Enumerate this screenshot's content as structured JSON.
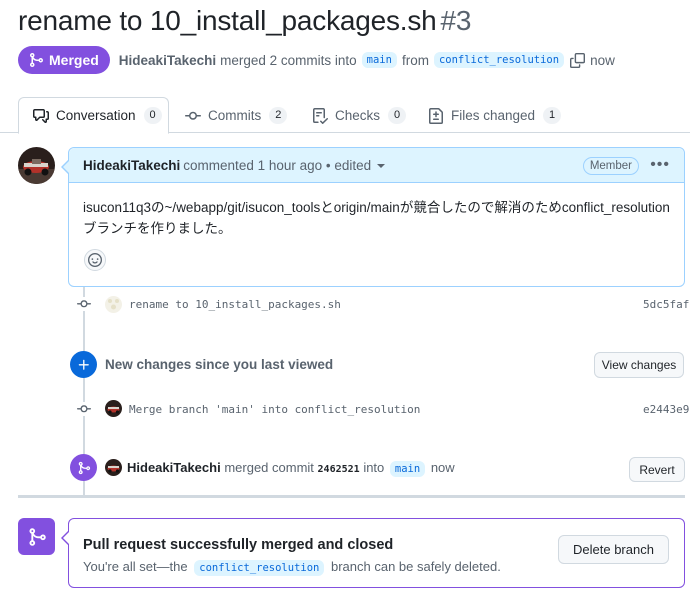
{
  "header": {
    "title": "rename to 10_install_packages.sh",
    "number": "#3",
    "state": "Merged",
    "author": "HideakiTakechi",
    "merge_text": "merged 2 commits into",
    "base_branch": "main",
    "from_text": "from",
    "head_branch": "conflict_resolution",
    "time": "now"
  },
  "tabs": [
    {
      "label": "Conversation",
      "count": "0",
      "icon": "comment-discussion-icon"
    },
    {
      "label": "Commits",
      "count": "2",
      "icon": "git-commit-icon"
    },
    {
      "label": "Checks",
      "count": "0",
      "icon": "checklist-icon"
    },
    {
      "label": "Files changed",
      "count": "1",
      "icon": "file-diff-icon"
    }
  ],
  "comment": {
    "author": "HideakiTakechi",
    "action": "commented 1 hour ago",
    "edited": "• edited",
    "role": "Member",
    "body": "isucon11q3の~/webapp/git/isucon_toolsとorigin/mainが競合したので解消のためconflict_resolutionブランチを作りました。"
  },
  "timeline": {
    "commit1": {
      "message": "rename to 10_install_packages.sh",
      "sha": "5dc5faf"
    },
    "new_changes": {
      "text": "New changes since you last viewed",
      "button": "View changes"
    },
    "commit2": {
      "message": "Merge branch 'main' into conflict_resolution",
      "sha": "e2443e9"
    },
    "merge_event": {
      "author": "HideakiTakechi",
      "action": "merged commit",
      "sha": "2462521",
      "into": "into",
      "branch": "main",
      "time": "now",
      "button": "Revert"
    }
  },
  "merged_box": {
    "title": "Pull request successfully merged and closed",
    "desc_prefix": "You're all set—the",
    "branch": "conflict_resolution",
    "desc_suffix": "branch can be safely deleted.",
    "button": "Delete branch"
  },
  "colors": {
    "merged": "#8250df",
    "accent": "#0969da",
    "border": "#d1d9e0",
    "comment_header": "#ddf4ff"
  }
}
